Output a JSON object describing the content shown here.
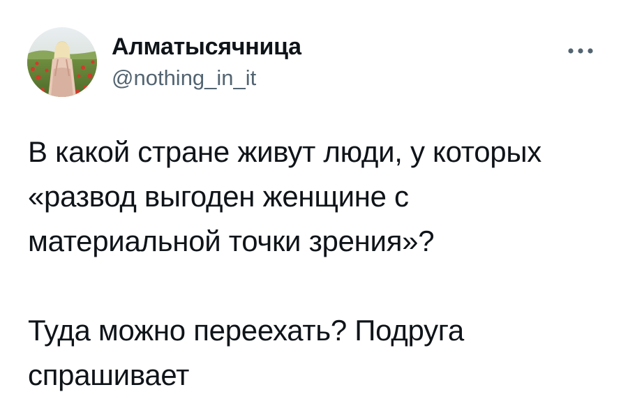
{
  "tweet": {
    "author": {
      "display_name": "Алматысячница",
      "handle": "@nothing_in_it",
      "avatar_icon": "profile-photo-woman-in-poppy-field"
    },
    "more_icon": "more-options-icon",
    "paragraphs": [
      "В какой стране живут люди, у которых\n«развод выгоден женщине с\nматериальной точки зрения»?",
      "Туда можно переехать? Подруга\nспрашивает"
    ]
  },
  "colors": {
    "text_primary": "#0f1419",
    "text_secondary": "#536471",
    "background": "#ffffff"
  }
}
